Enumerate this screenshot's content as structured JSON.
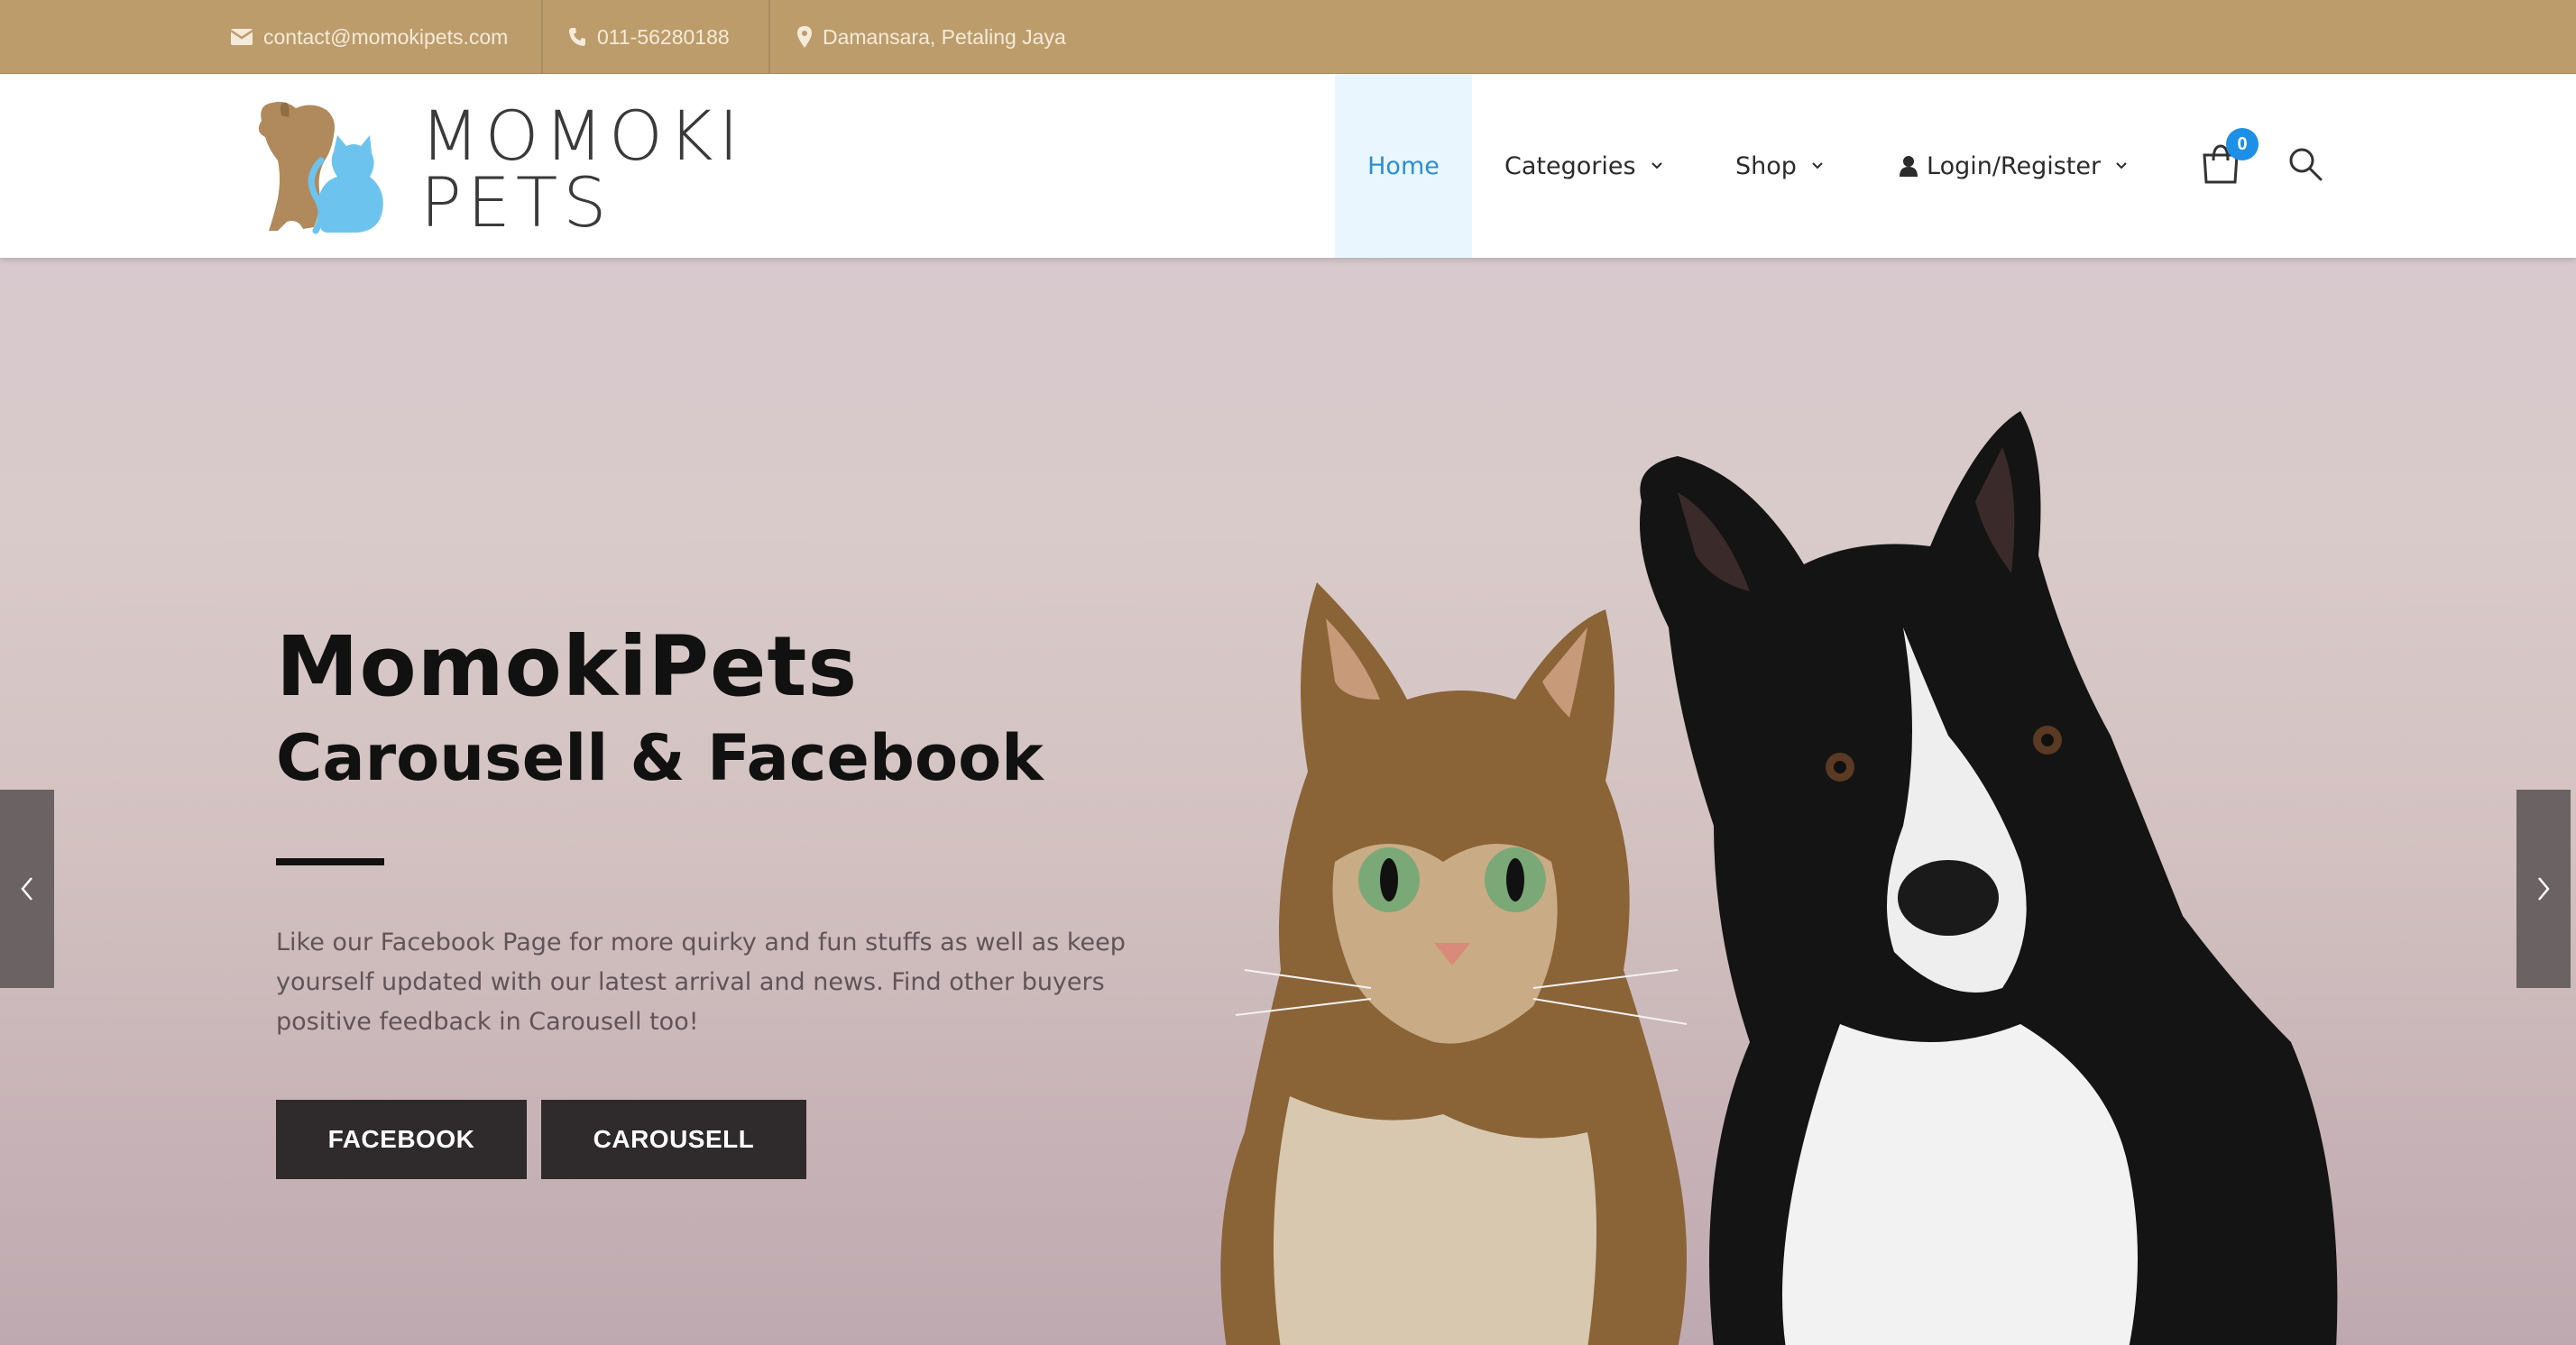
{
  "topbar": {
    "email": "contact@momokipets.com",
    "phone": "011-56280188",
    "location": "Damansara, Petaling Jaya",
    "icons": [
      "envelope-icon",
      "phone-icon",
      "map-pin-icon"
    ],
    "color": "#bd9c6c"
  },
  "brand": {
    "line1": "MOMOKI",
    "line2": "PETS",
    "colors": {
      "dog": "#b08a5c",
      "cat": "#6cc3ee"
    }
  },
  "nav": {
    "items": [
      {
        "label": "Home",
        "active": true
      },
      {
        "label": "Categories",
        "dropdown": true
      },
      {
        "label": "Shop",
        "dropdown": true
      },
      {
        "label": "Login/Register",
        "dropdown": true,
        "icon": "user-icon"
      }
    ],
    "cart_count": "0",
    "accent": "#2b8fd6"
  },
  "hero": {
    "title": "MomokiPets",
    "subtitle": "Carousell & Facebook",
    "description": "Like our Facebook Page for more quirky and fun stuffs as well as keep yourself updated with our latest arrival and news. Find other buyers positive feedback in Carousell too!",
    "buttons": [
      "FACEBOOK",
      "CAROUSELL"
    ],
    "image": "cat-and-dog-photo"
  }
}
